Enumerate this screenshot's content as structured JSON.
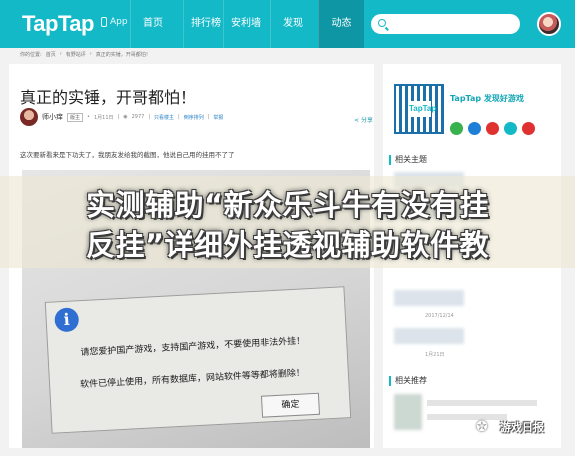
{
  "nav": {
    "logo": "TapTap",
    "app_label": "App",
    "tabs": [
      "首页",
      "排行榜",
      "安利墙",
      "发现",
      "动态"
    ],
    "active_tab": "动态",
    "accent": "#14b9c8"
  },
  "breadcrumb": [
    "你的位置:",
    "首页",
    "有野站评",
    "真正的实锤，开哥都怕！"
  ],
  "article": {
    "title": "真正的实锤，开哥都怕！",
    "author": "师小痒",
    "author_tag": "版主",
    "date": "1月11日",
    "views": "2977",
    "links": [
      "只看楼主",
      "倒序排列",
      "举报"
    ],
    "share": "分享",
    "intro": "这次要新看来是下功夫了，我朋友发给我的截图，他说自己用的挂用不了了",
    "dialog": {
      "line1": "请您爱护国产游戏，支持国产游戏，不要使用非法外挂！",
      "line2": "软件已停止使用，所有数据库，网站软件等等都将删除！",
      "ok": "确定"
    }
  },
  "sidebar": {
    "promo": "TapTap 发现好游戏",
    "qr_text": "TapTap",
    "related_title": "相关主题",
    "related_dates": [
      "2017/12/14",
      "1月21日"
    ],
    "recommend_title": "相关推荐",
    "social_colors": [
      "#37b24d",
      "#1e7fd6",
      "#e03131",
      "#14b9c8",
      "#e03131"
    ]
  },
  "banner": {
    "line1": "实测辅助“新众乐斗牛有没有挂",
    "line2": "反挂”详细外挂透视辅助软件教"
  },
  "watermark": {
    "text": "游戏日报"
  }
}
